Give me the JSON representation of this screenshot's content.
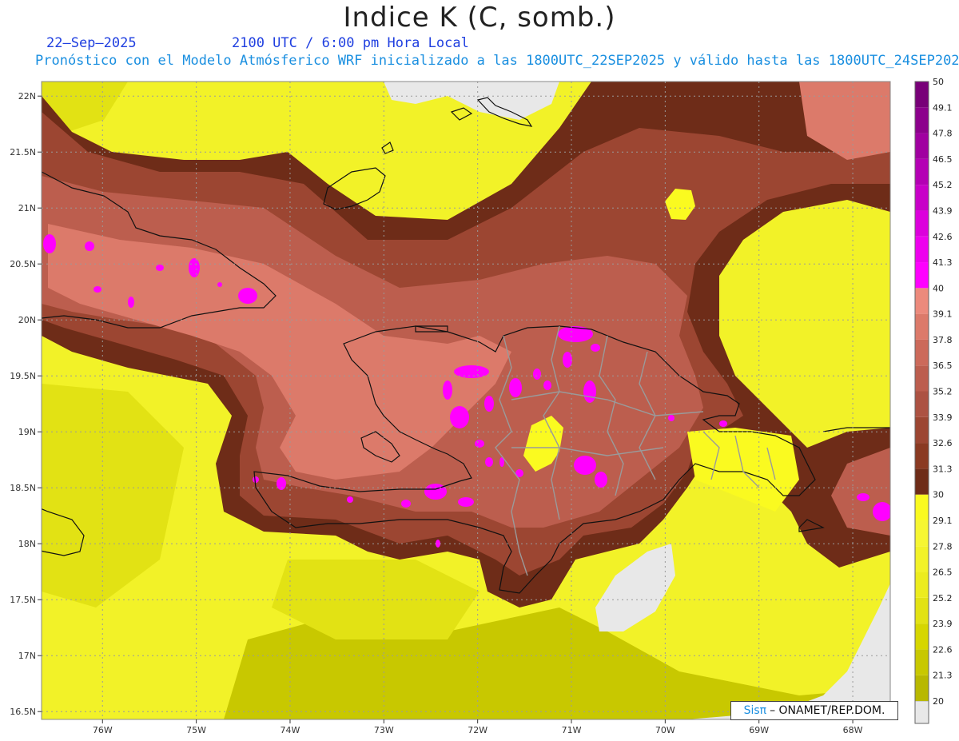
{
  "title": "Indice K (C, somb.)",
  "date": "22—Sep—2025",
  "valid_time": "2100 UTC / 6:00 pm Hora Local",
  "description": "Pronóstico con el Modelo Atmósferico WRF inicializado a las 1800UTC_22SEP2025 y válido hasta las  1800UTC_24SEP2025",
  "credit": {
    "brand": "Sisπ",
    "text": "– ONAMET/REP.DOM."
  },
  "map": {
    "lat_labels": [
      "22N",
      "21.5N",
      "21N",
      "20.5N",
      "20N",
      "19.5N",
      "19N",
      "18.5N",
      "18N",
      "17.5N",
      "17N",
      "16.5N"
    ],
    "lon_labels": [
      "76W",
      "75W",
      "74W",
      "73W",
      "72W",
      "71W",
      "70W",
      "69W",
      "68W"
    ],
    "lat_values": [
      22,
      21.5,
      21,
      20.5,
      20,
      19.5,
      19,
      18.5,
      18,
      17.5,
      17,
      16.5
    ],
    "lon_values": [
      -76,
      -75,
      -74,
      -73,
      -72,
      -71,
      -70,
      -69,
      -68
    ],
    "extent": {
      "lon_min": -76.65,
      "lon_max": -67.6,
      "lat_min": 16.43,
      "lat_max": 22.13
    }
  },
  "colorbar": {
    "levels": [
      "20",
      "21.3",
      "22.6",
      "23.9",
      "25.2",
      "26.5",
      "27.8",
      "29.1",
      "30",
      "31.3",
      "32.6",
      "33.9",
      "35.2",
      "36.5",
      "37.8",
      "39.1",
      "40",
      "41.3",
      "42.6",
      "43.9",
      "45.2",
      "46.5",
      "47.8",
      "49.1",
      "50"
    ],
    "colors": [
      "#b8b800",
      "#c8c800",
      "#d6d600",
      "#e2e214",
      "#ecec1e",
      "#f2f228",
      "#f6f632",
      "#fafa20",
      "#6e2c18",
      "#8a3a22",
      "#9c4632",
      "#ac5242",
      "#bc5e4e",
      "#cc6a5a",
      "#dc7a6a",
      "#ec8a7c",
      "#ff00ff",
      "#ee00ee",
      "#dc00dc",
      "#c800c8",
      "#b400b4",
      "#a000a0",
      "#8c008c",
      "#780078"
    ],
    "missing_color": "#e8e8e8"
  }
}
